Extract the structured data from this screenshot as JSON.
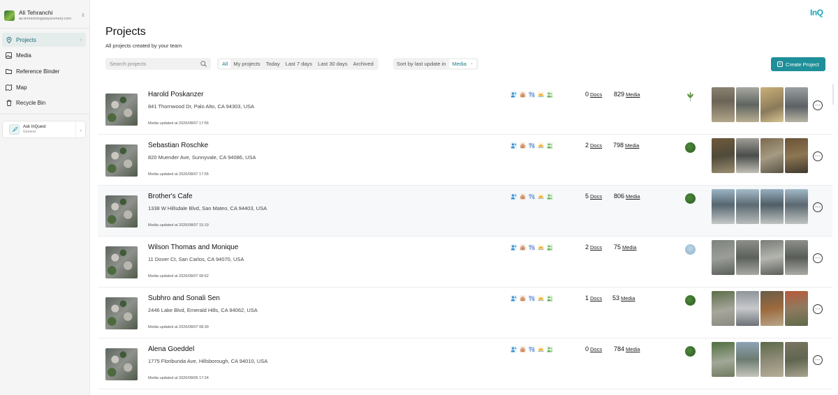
{
  "user": {
    "name": "Ali Tehranchi",
    "email": "ali.tehranchi@bayscenery.com"
  },
  "sidebar": {
    "items": [
      {
        "label": "Projects",
        "icon": "location-pin-icon",
        "active": true
      },
      {
        "label": "Media",
        "icon": "image-icon"
      },
      {
        "label": "Reference Binder",
        "icon": "folder-icon"
      },
      {
        "label": "Map",
        "icon": "map-icon"
      },
      {
        "label": "Recycle Bin",
        "icon": "trash-icon"
      }
    ],
    "ask": {
      "title": "Ask InQuest",
      "subtitle": "General"
    }
  },
  "brand": {
    "logo_text": "InQ"
  },
  "header": {
    "title": "Projects",
    "subtitle": "All projects created by your team"
  },
  "search": {
    "placeholder": "Search projects"
  },
  "filters": [
    "All",
    "My projects",
    "Today",
    "Last 7 days",
    "Last 30 days",
    "Archived"
  ],
  "sort": {
    "label": "Sort by last update in",
    "value": "Media"
  },
  "actions": {
    "create_label": "Create Project"
  },
  "colors": {
    "accent": "#1f8f99",
    "active_text": "#1b7c86"
  },
  "projects": [
    {
      "name": "Harold Poskanzer",
      "address": "841 Thornwood Dr, Palo Alto, CA 94303, USA",
      "updated": "Media updated at 2026/08/07 17:56",
      "docs": "0",
      "docs_label": "Docs",
      "media": "829",
      "media_label": "Media"
    },
    {
      "name": "Sebastian Roschke",
      "address": "820 Muender Ave, Sunnyvale, CA 94086, USA",
      "updated": "Media updated at 2026/08/07 17:55",
      "docs": "2",
      "docs_label": "Docs",
      "media": "798",
      "media_label": "Media"
    },
    {
      "name": "Brother's Cafe",
      "address": "1338 W Hillsdale Blvd, San Mateo, CA 94403, USA",
      "updated": "Media updated at 2026/08/07 15:19",
      "docs": "5",
      "docs_label": "Docs",
      "media": "806",
      "media_label": "Media"
    },
    {
      "name": "Wilson Thomas and Monique",
      "address": "11 Dover Ct, San Carlos, CA 94070, USA",
      "updated": "Media updated at 2026/08/07 08:52",
      "docs": "2",
      "docs_label": "Docs",
      "media": "75",
      "media_label": "Media"
    },
    {
      "name": "Subhro and Sonali Sen",
      "address": "2446 Lake Blvd, Emerald Hills, CA 94062, USA",
      "updated": "Media updated at 2026/08/07 08:39",
      "docs": "1",
      "docs_label": "Docs",
      "media": "53",
      "media_label": "Media"
    },
    {
      "name": "Alena Goeddel",
      "address": "1775 Floribunda Ave, Hillsborough, CA 94010, USA",
      "updated": "Media updated at 2026/08/06 17:24",
      "docs": "0",
      "docs_label": "Docs",
      "media": "784",
      "media_label": "Media"
    }
  ]
}
